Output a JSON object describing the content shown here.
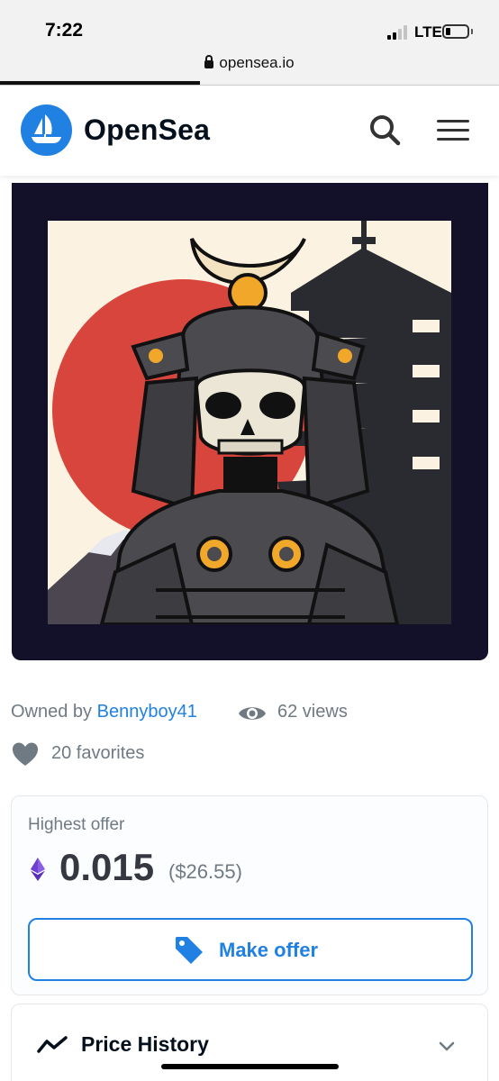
{
  "status_bar": {
    "time": "7:22",
    "network": "LTE",
    "url": "opensea.io"
  },
  "header": {
    "brand": "OpenSea",
    "brand_color": "#2081e2",
    "icons": [
      "search-icon",
      "hamburger-menu-icon"
    ]
  },
  "asset": {
    "image_description_icon": "samurai-skull-artwork",
    "owned_by_label": "Owned by",
    "owner": "Bennyboy41",
    "views": "62 views",
    "favorites": "20 favorites"
  },
  "offer": {
    "label": "Highest offer",
    "currency_icon": "ethereum-icon",
    "price": "0.015",
    "price_usd": "($26.55)",
    "button_label": "Make offer"
  },
  "price_history": {
    "title": "Price History",
    "expanded": false
  },
  "colors": {
    "accent": "#2081e2",
    "text_secondary": "#707a83",
    "eth_purple": "#6f3fd0"
  }
}
